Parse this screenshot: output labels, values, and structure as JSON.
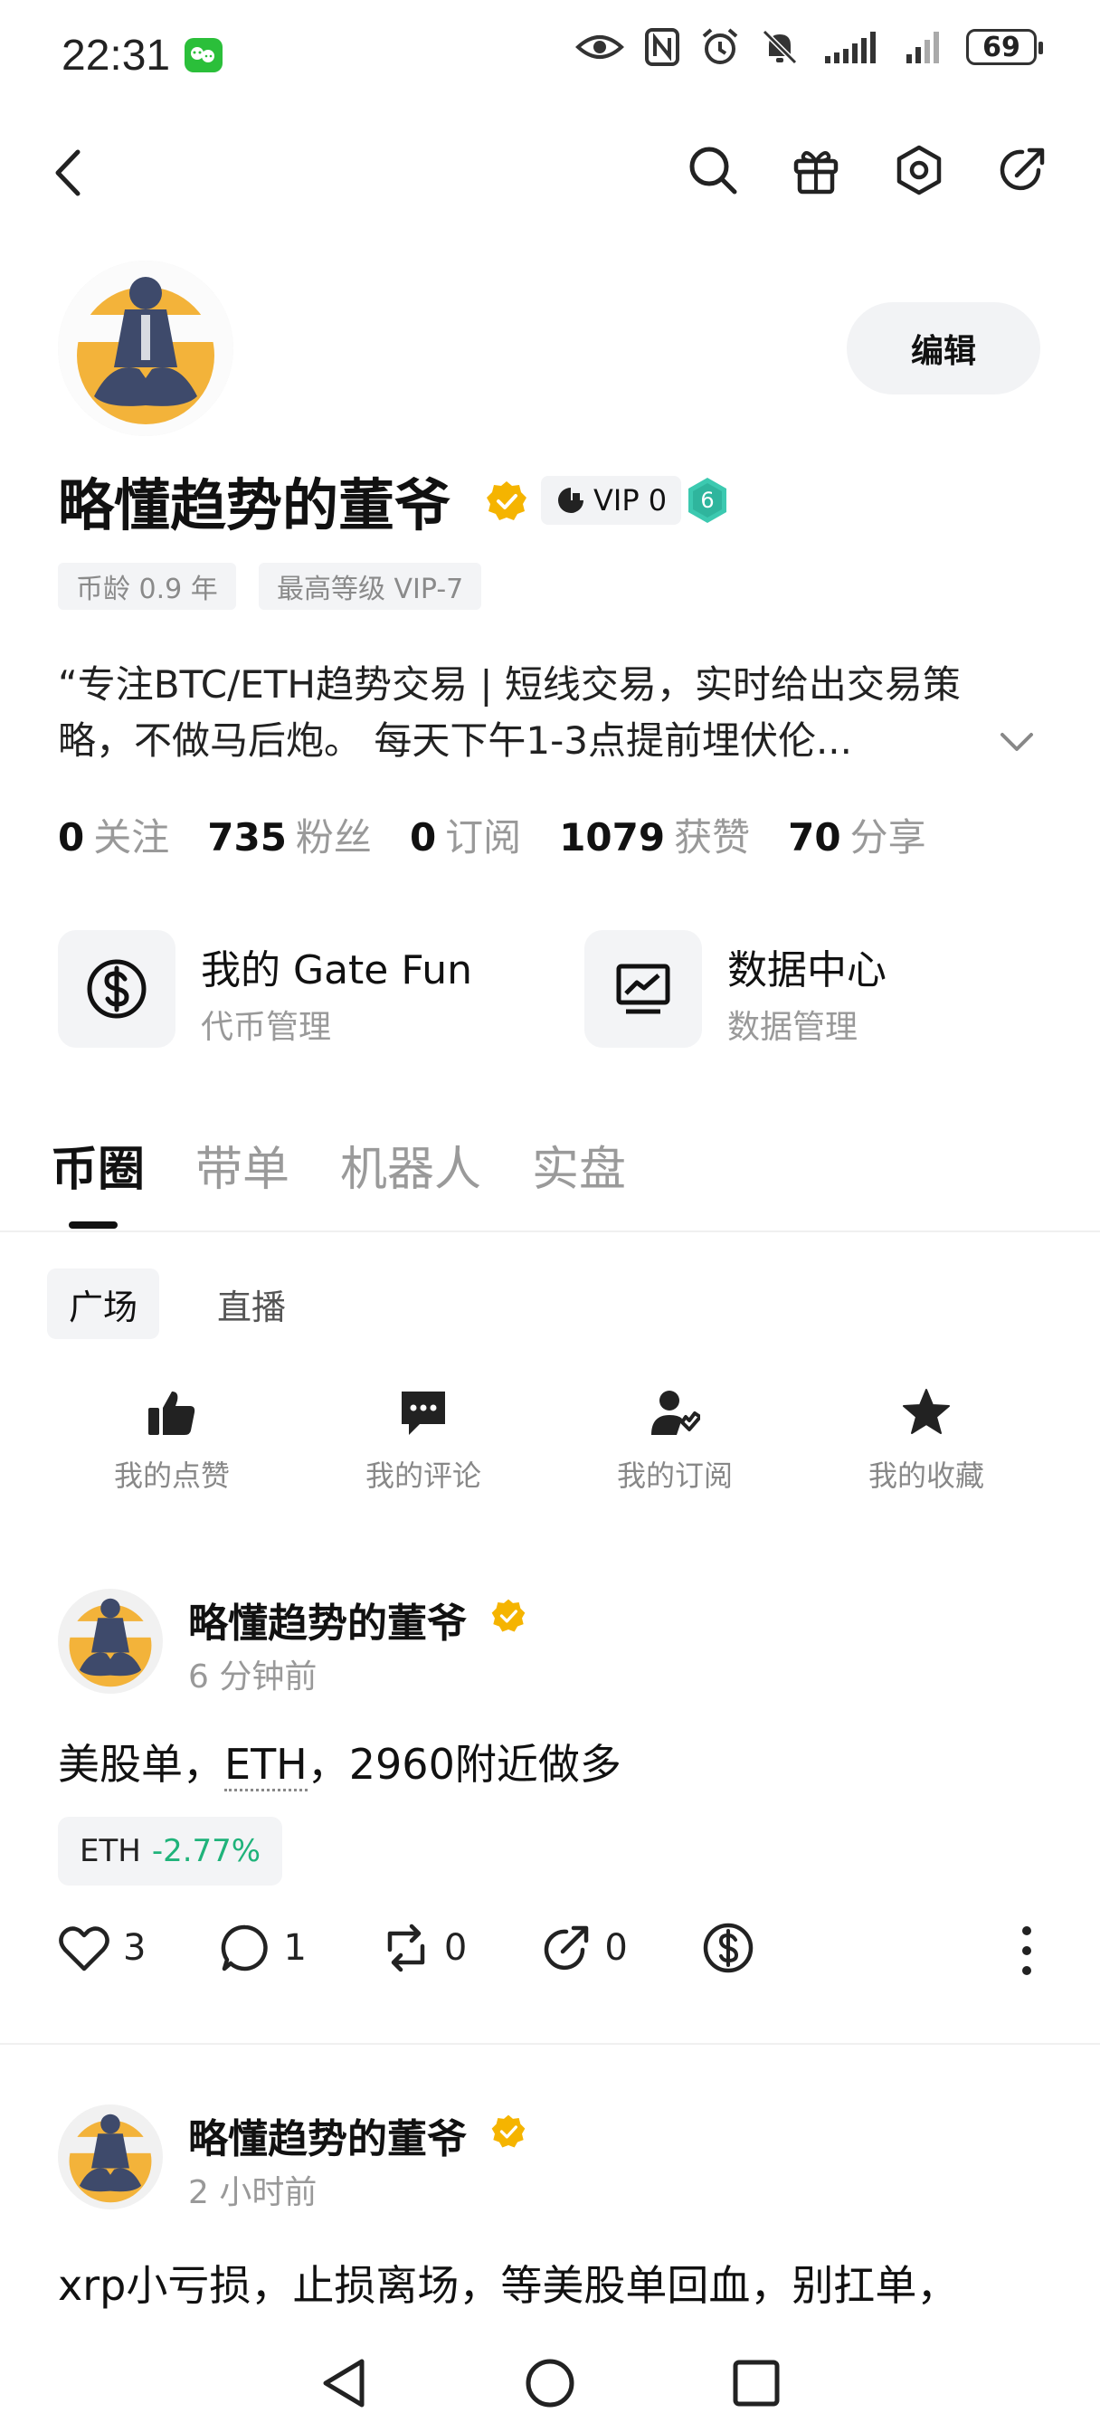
{
  "status_bar": {
    "time": "22:31",
    "battery": "69",
    "icons": [
      "wechat-icon",
      "eye-icon",
      "nfc-icon",
      "alarm-icon",
      "mute-icon",
      "signal-icon",
      "signal-icon-2",
      "battery-icon"
    ]
  },
  "nav": {
    "icons": [
      "back-icon",
      "search-icon",
      "gift-icon",
      "settings-icon",
      "share-icon"
    ]
  },
  "profile": {
    "edit_label": "编辑",
    "name": "略懂趋势的董爷",
    "vip_label": "VIP 0",
    "level": "6",
    "tags": [
      "币龄 0.9 年",
      "最高等级 VIP-7"
    ],
    "bio_line1": "“专注BTC/ETH趋势交易 | 短线交易，实时给出交易策",
    "bio_line2": "略，不做马后炮。 每天下午1-3点提前埋伏伦..."
  },
  "stats": [
    {
      "num": "0",
      "label": "关注"
    },
    {
      "num": "735",
      "label": "粉丝"
    },
    {
      "num": "0",
      "label": "订阅"
    },
    {
      "num": "1079",
      "label": "获赞"
    },
    {
      "num": "70",
      "label": "分享"
    }
  ],
  "cards": [
    {
      "title": "我的 Gate Fun",
      "sub": "代币管理",
      "icon": "dollar-circle-icon"
    },
    {
      "title": "数据中心",
      "sub": "数据管理",
      "icon": "chart-monitor-icon"
    }
  ],
  "main_tabs": [
    "币圈",
    "带单",
    "机器人",
    "实盘"
  ],
  "sub_tabs": [
    "广场",
    "直播"
  ],
  "quick_actions": [
    {
      "label": "我的点赞",
      "icon": "thumbs-up-icon"
    },
    {
      "label": "我的评论",
      "icon": "comment-icon"
    },
    {
      "label": "我的订阅",
      "icon": "subscribe-icon"
    },
    {
      "label": "我的收藏",
      "icon": "star-icon"
    }
  ],
  "posts": [
    {
      "name": "略懂趋势的董爷",
      "time": "6 分钟前",
      "body_before": "美股单，",
      "body_link": "ETH",
      "body_after": "，2960附近做多",
      "coin": "ETH",
      "change": "-2.77%",
      "likes": "3",
      "comments": "1",
      "reposts": "0",
      "shares": "0"
    },
    {
      "name": "略懂趋势的董爷",
      "time": "2 小时前",
      "body": "xrp小亏损，止损离场，等美股单回血，别扛单，"
    }
  ],
  "colors": {
    "verified": "#f5b400",
    "level_badge": "#3cc9b0",
    "negative_change": "#1fb37a"
  }
}
